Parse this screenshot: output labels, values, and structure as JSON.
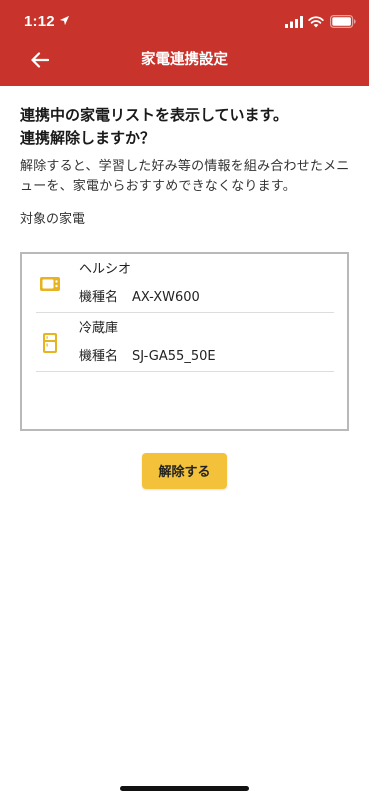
{
  "status_bar": {
    "time": "1:12",
    "icons": [
      "location-arrow-icon",
      "cellular-signal-icon",
      "wifi-icon",
      "battery-icon"
    ]
  },
  "header": {
    "title": "家電連携設定",
    "back_icon": "arrow-left-icon"
  },
  "main": {
    "headline_line1": "連携中の家電リストを表示しています。",
    "headline_line2": "連携解除しますか？",
    "description": "解除すると、学習した好み等の情報を組み合わせたメニューを、家電からおすすめできなくなります。",
    "section_label": "対象の家電"
  },
  "devices": [
    {
      "name": "ヘルシオ",
      "model_label": "機種名",
      "model": "AX-XW600",
      "icon": "microwave-oven-icon"
    },
    {
      "name": "冷蔵庫",
      "model_label": "機種名",
      "model": "SJ-GA55_50E",
      "icon": "refrigerator-icon"
    }
  ],
  "actions": {
    "unlink_label": "解除する"
  },
  "colors": {
    "header_bg": "#c8342b",
    "accent_yellow": "#f3c23a",
    "icon_gold": "#e8b320",
    "border_gray": "#b9b9b9"
  }
}
